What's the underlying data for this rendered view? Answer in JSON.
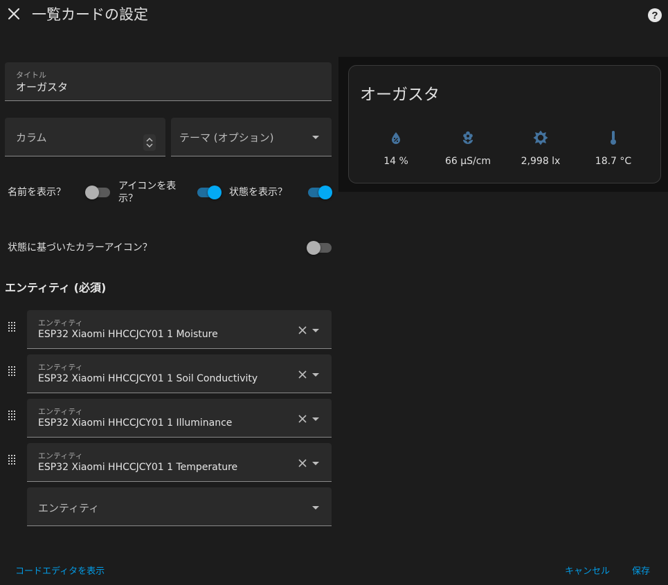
{
  "header": {
    "title": "一覧カードの設定"
  },
  "form": {
    "title_field": {
      "label": "タイトル",
      "value": "オーガスタ"
    },
    "columns_field": {
      "placeholder": "カラム"
    },
    "theme_field": {
      "placeholder": "テーマ (オプション)"
    },
    "toggles": {
      "show_name": {
        "label": "名前を表示？",
        "on": false
      },
      "show_icon": {
        "label_line1": "アイコンを表",
        "label_line2": "示？",
        "on": true
      },
      "show_state": {
        "label": "状態を表示？",
        "on": true
      },
      "state_color": {
        "label": "状態に基づいたカラーアイコン？",
        "on": false
      }
    },
    "entities_section": {
      "title": "エンティティ (必須)",
      "items": [
        {
          "label": "エンティティ",
          "value": "ESP32 Xiaomi HHCCJCY01 1 Moisture"
        },
        {
          "label": "エンティティ",
          "value": "ESP32 Xiaomi HHCCJCY01 1 Soil Conductivity"
        },
        {
          "label": "エンティティ",
          "value": "ESP32 Xiaomi HHCCJCY01 1 Illuminance"
        },
        {
          "label": "エンティティ",
          "value": "ESP32 Xiaomi HHCCJCY01 1 Temperature"
        }
      ],
      "empty_placeholder": "エンティティ"
    }
  },
  "preview": {
    "card_title": "オーガスタ",
    "entities": [
      {
        "icon": "water-percent-icon",
        "value": "14 %"
      },
      {
        "icon": "flower-icon",
        "value": "66 µS/cm"
      },
      {
        "icon": "brightness-icon",
        "value": "2,998 lx"
      },
      {
        "icon": "thermometer-icon",
        "value": "18.7 °C"
      }
    ],
    "icon_color": "#44739e"
  },
  "footer": {
    "code_editor": "コードエディタを表示",
    "cancel": "キャンセル",
    "save": "保存"
  },
  "colors": {
    "accent": "#03a9f4",
    "link": "#039be5",
    "background": "#1c1c1c"
  }
}
